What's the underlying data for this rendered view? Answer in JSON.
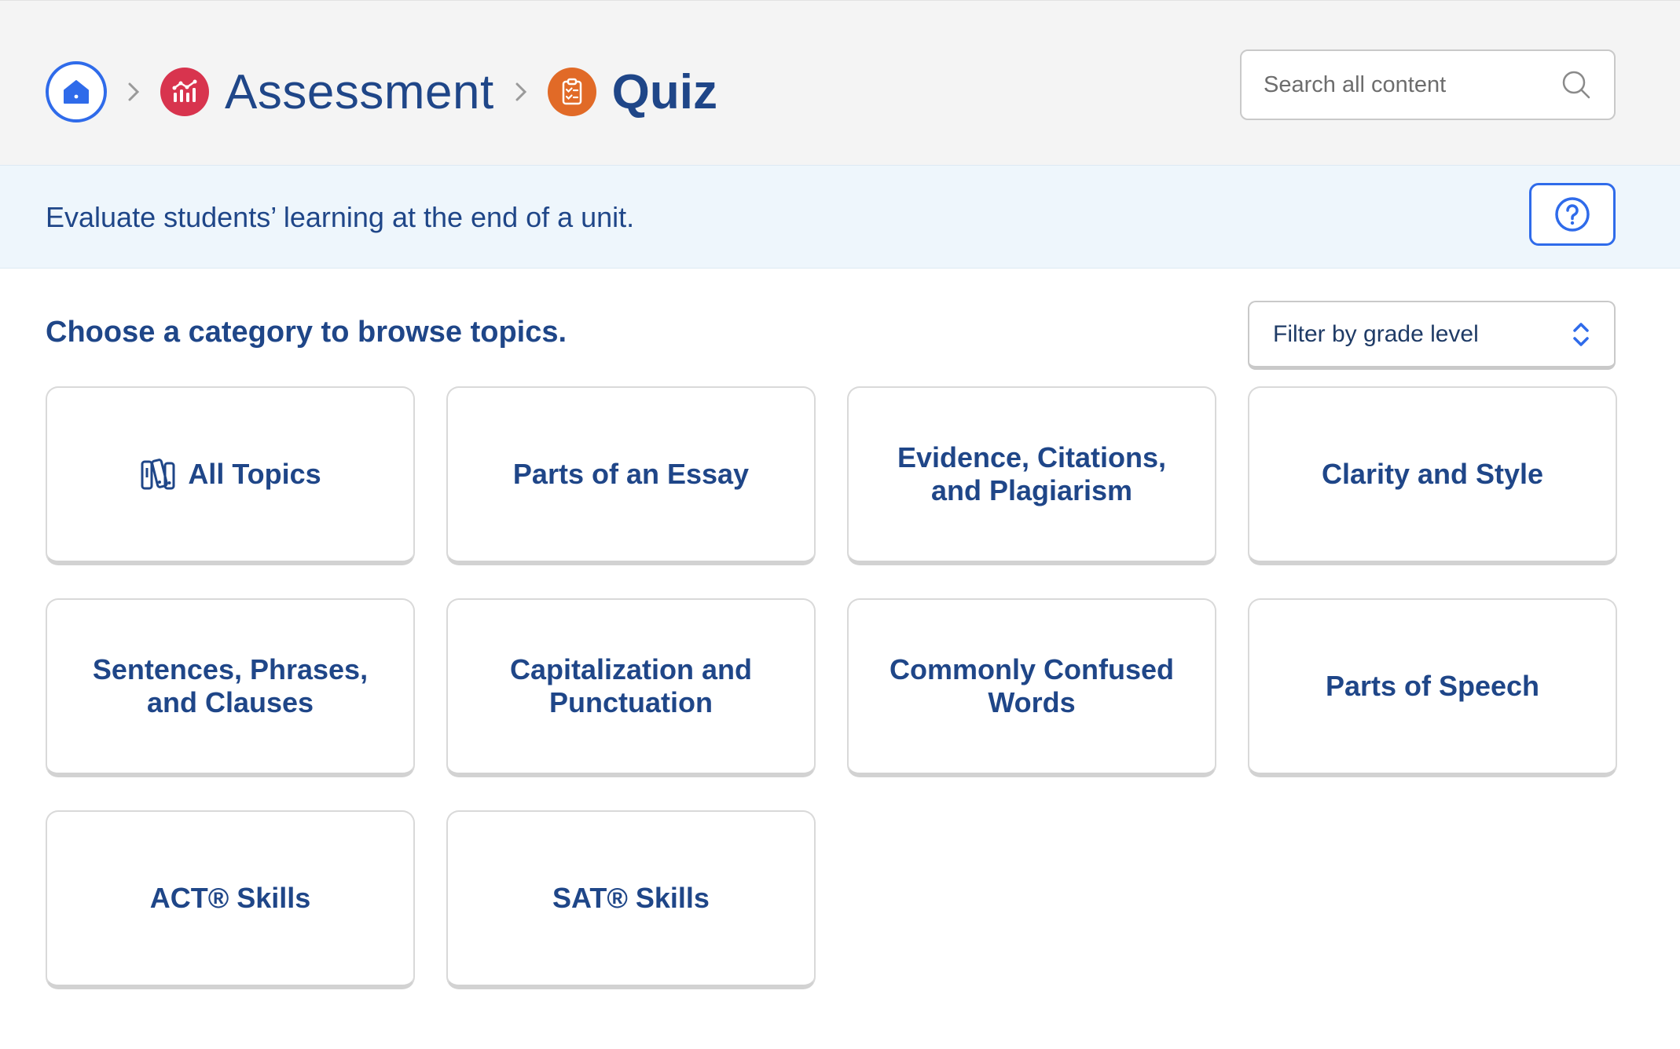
{
  "breadcrumb": {
    "home_icon": "home-icon",
    "items": [
      {
        "label": "Assessment",
        "icon": "chart-icon",
        "color": "#d8344e"
      },
      {
        "label": "Quiz",
        "icon": "clipboard-check-icon",
        "color": "#e16a27"
      }
    ]
  },
  "search": {
    "placeholder": "Search all content",
    "icon": "search-icon"
  },
  "banner": {
    "text": "Evaluate students’ learning at the end of a unit.",
    "help_icon": "question-circle-icon"
  },
  "section": {
    "title": "Choose a category to browse topics."
  },
  "filter": {
    "label": "Filter by grade level",
    "icon": "up-down-chevron-icon"
  },
  "categories": [
    {
      "label": "All Topics",
      "icon": "books-icon"
    },
    {
      "label": "Parts of an Essay"
    },
    {
      "label": "Evidence, Citations, and Plagiarism"
    },
    {
      "label": "Clarity and Style"
    },
    {
      "label": "Sentences, Phrases, and Clauses"
    },
    {
      "label": "Capitalization and Punctuation"
    },
    {
      "label": "Commonly Confused Words"
    },
    {
      "label": "Parts of Speech"
    },
    {
      "label": "ACT® Skills"
    },
    {
      "label": "SAT® Skills"
    }
  ],
  "colors": {
    "accent": "#2f6bea",
    "text": "#1f4688",
    "header_bg": "#f4f4f4",
    "banner_bg": "#eef6fc"
  }
}
